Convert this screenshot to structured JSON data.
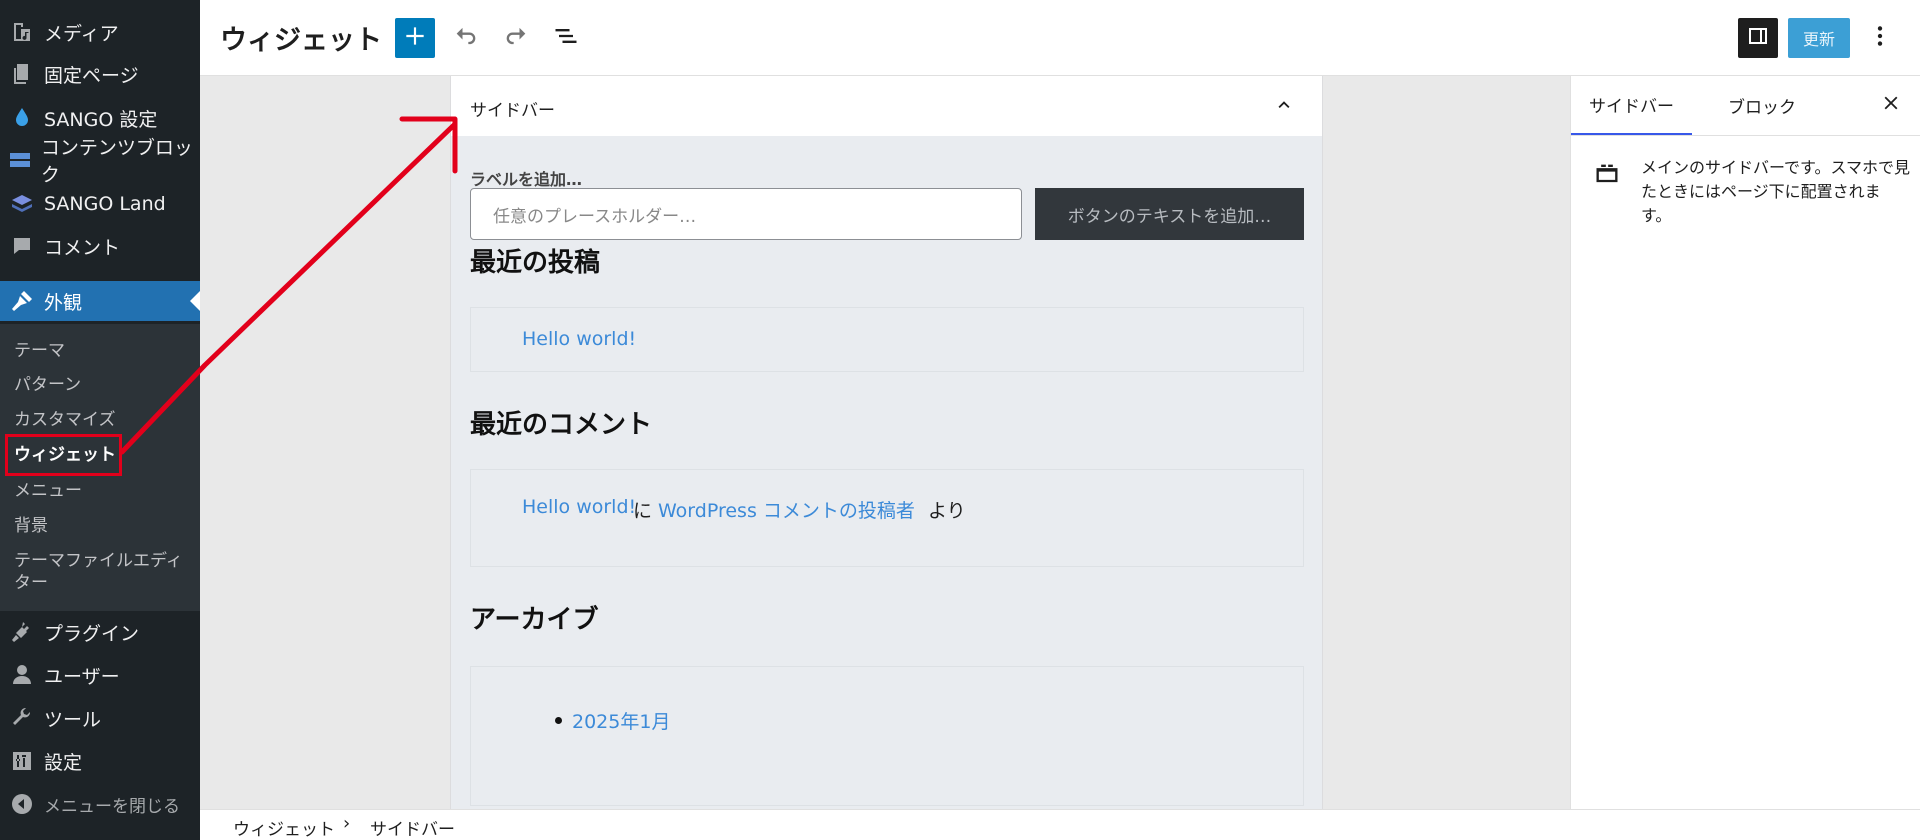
{
  "admin_menu": {
    "items": [
      {
        "label": "メディア",
        "icon": "media-icon"
      },
      {
        "label": "固定ページ",
        "icon": "pages-icon"
      },
      {
        "label": "SANGO 設定",
        "icon": "drop-icon"
      },
      {
        "label": "コンテンツブロック",
        "icon": "content-block-icon"
      },
      {
        "label": "SANGO Land",
        "icon": "layers-icon"
      },
      {
        "label": "コメント",
        "icon": "comment-icon"
      },
      {
        "label": "外観",
        "icon": "appearance-icon"
      },
      {
        "label": "プラグイン",
        "icon": "plugin-icon"
      },
      {
        "label": "ユーザー",
        "icon": "user-icon"
      },
      {
        "label": "ツール",
        "icon": "tool-icon"
      },
      {
        "label": "設定",
        "icon": "settings-icon"
      },
      {
        "label": "メニューを閉じる",
        "icon": "collapse-icon"
      }
    ],
    "submenu": [
      {
        "label": "テーマ"
      },
      {
        "label": "パターン"
      },
      {
        "label": "カスタマイズ"
      },
      {
        "label": "ウィジェット"
      },
      {
        "label": "メニュー"
      },
      {
        "label": "背景"
      },
      {
        "label": "テーマファイルエディター"
      }
    ]
  },
  "header": {
    "title": "ウィジェット",
    "update_label": "更新"
  },
  "widget_area": {
    "title": "サイドバー",
    "search": {
      "label": "ラベルを追加…",
      "placeholder": "任意のプレースホルダー…",
      "button": "ボタンのテキストを追加…"
    },
    "recent_posts": {
      "heading": "最近の投稿",
      "items": [
        "Hello world!"
      ]
    },
    "recent_comments": {
      "heading": "最近のコメント",
      "post_link": "Hello world!",
      "on_text": "に",
      "author_link": "WordPress コメントの投稿者",
      "from_text": "より"
    },
    "archives": {
      "heading": "アーカイブ",
      "items": [
        "2025年1月"
      ]
    }
  },
  "settings_panel": {
    "tabs": [
      "サイドバー",
      "ブロック"
    ],
    "description": "メインのサイドバーです。スマホで見たときにはページ下に配置されます。"
  },
  "breadcrumb": {
    "items": [
      "ウィジェット",
      "サイドバー"
    ],
    "separator": "›"
  },
  "colors": {
    "admin_bg": "#1d2327",
    "admin_submenu_bg": "#2c3338",
    "admin_active": "#2271b1",
    "primary": "#007cba",
    "link": "#3c8ad8",
    "annotation": "#e2001b"
  }
}
